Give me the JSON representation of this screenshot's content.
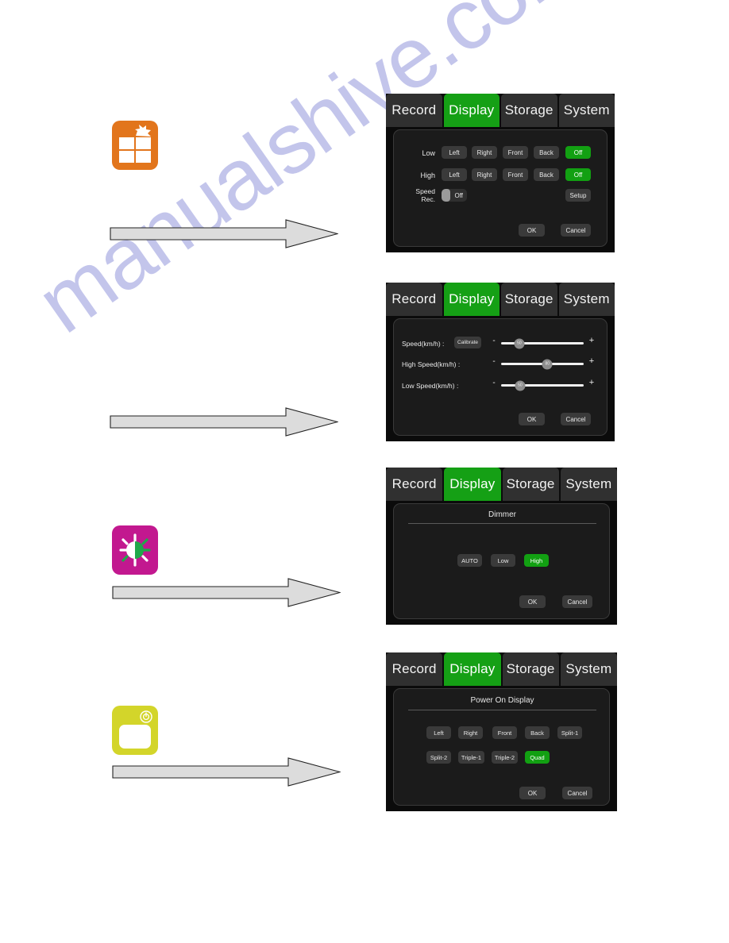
{
  "watermark": {
    "text": "manualshive.com"
  },
  "icons": [
    {
      "name": "quad-view-icon",
      "label": "Quad view icon",
      "color": "#e2751c"
    },
    {
      "name": "dimmer-icon",
      "label": "Dimmer icon",
      "color": "#c2188f"
    },
    {
      "name": "power-on-display-icon",
      "label": "Power on display icon",
      "color": "#d3d52a"
    }
  ],
  "tabs": {
    "record": "Record",
    "display": "Display",
    "storage": "Storage",
    "system": "System",
    "active": "Display"
  },
  "common": {
    "ok": "OK",
    "cancel": "Cancel"
  },
  "panel1": {
    "rows": [
      {
        "label": "Low",
        "buttons": [
          "Left",
          "Right",
          "Front",
          "Back"
        ],
        "state_label": "Off",
        "state_on": true
      },
      {
        "label": "High",
        "buttons": [
          "Left",
          "Right",
          "Front",
          "Back"
        ],
        "state_label": "Off",
        "state_on": true
      }
    ],
    "speed_rec": {
      "label_line1": "Speed",
      "label_line2": "Rec.",
      "toggle_value": "Off",
      "setup_label": "Setup"
    }
  },
  "panel2": {
    "sliders": [
      {
        "label": "Speed(km/h) :",
        "button": "Calibrate",
        "minus": "-",
        "plus": "+",
        "value": "50",
        "percent": 22
      },
      {
        "label": "High Speed(km/h) :",
        "button": "",
        "minus": "-",
        "plus": "+",
        "value": "80",
        "percent": 56
      },
      {
        "label": "Low Speed(km/h) :",
        "button": "",
        "minus": "-",
        "plus": "+",
        "value": "50",
        "percent": 23
      }
    ]
  },
  "panel3": {
    "title": "Dimmer",
    "options": [
      {
        "label": "AUTO",
        "selected": false
      },
      {
        "label": "Low",
        "selected": false
      },
      {
        "label": "High",
        "selected": true
      }
    ]
  },
  "panel4": {
    "title": "Power On Display",
    "row1": [
      {
        "label": "Left",
        "selected": false
      },
      {
        "label": "Right",
        "selected": false
      },
      {
        "label": "Front",
        "selected": false
      },
      {
        "label": "Back",
        "selected": false
      },
      {
        "label": "Split-1",
        "selected": false
      }
    ],
    "row2": [
      {
        "label": "Split-2",
        "selected": false
      },
      {
        "label": "Triple-1",
        "selected": false
      },
      {
        "label": "Triple-2",
        "selected": false
      },
      {
        "label": "Quad",
        "selected": true
      }
    ]
  }
}
